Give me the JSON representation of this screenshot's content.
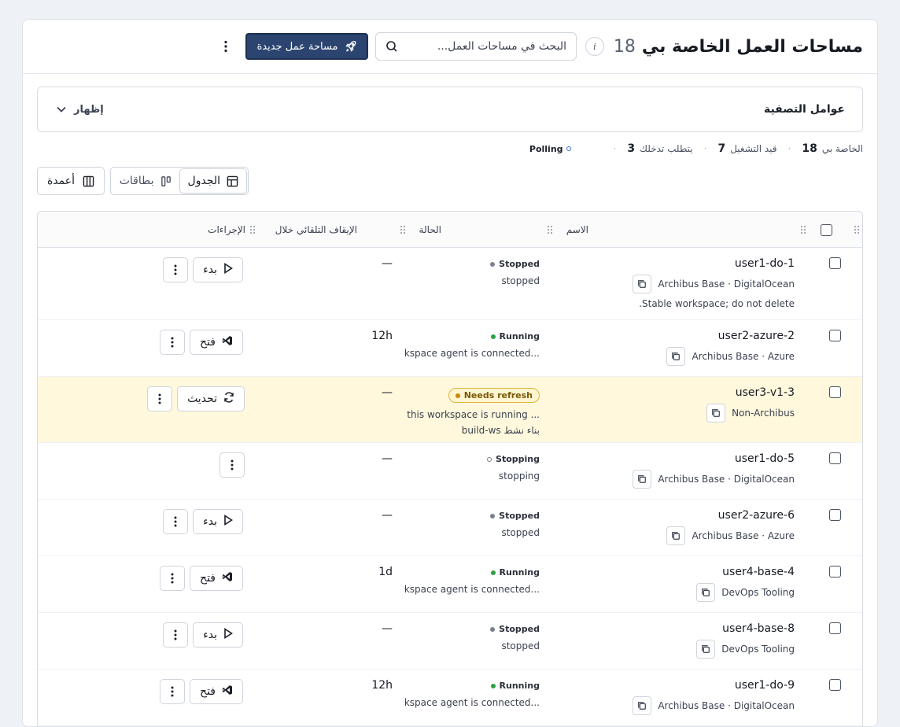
{
  "header": {
    "title": "مساحات العمل الخاصة بي",
    "count": "18",
    "info_icon": "i",
    "search_placeholder": "البحث في مساحات العمل...",
    "new_button": "مساحة عمل جديدة"
  },
  "filters": {
    "title": "عوامل التصفية",
    "toggle": "إظهار"
  },
  "summary": {
    "mine_label": "الخاصة بي",
    "mine_count": "18",
    "running_label": "قيد التشغيل",
    "running_count": "7",
    "attention_label": "يتطلب تدخلك",
    "attention_count": "3",
    "polling": "Polling"
  },
  "view": {
    "table": "الجدول",
    "cards": "بطاقات",
    "columns": "أعمدة"
  },
  "table": {
    "columns": {
      "name": "الاسم",
      "status": "الحالة",
      "autostop": "الإيقاف التلقائي خلال",
      "actions": "الإجراءات"
    },
    "rows": [
      {
        "name": "user1-do-1",
        "template": "Archibus Base · DigitalOcean",
        "note": "Stable workspace; do not delete.",
        "status": "Stopped",
        "status_color": "#7a808c",
        "status_sub": "stopped",
        "status_sub2": "",
        "autostop": "—",
        "action": "بدء",
        "action_icon": "play"
      },
      {
        "name": "user2-azure-2",
        "template": "Archibus Base · Azure",
        "note": "",
        "status": "Running",
        "status_color": "#2ea043",
        "status_sub": "...kspace agent is connected",
        "status_sub2": "",
        "autostop": "12h",
        "action": "فتح",
        "action_icon": "vscode"
      },
      {
        "name": "user3-v1-3",
        "template": "Non-Archibus",
        "note": "",
        "status": "Needs refresh",
        "status_color": "#c98a00",
        "status_sub": "... this workspace is running",
        "status_sub2": "بناء نشط build-ws",
        "autostop": "—",
        "action": "تحديث",
        "action_icon": "refresh"
      },
      {
        "name": "user1-do-5",
        "template": "Archibus Base · DigitalOcean",
        "note": "",
        "status": "Stopping",
        "status_color": "#7a808c",
        "status_sub": "stopping",
        "status_sub2": "",
        "autostop": "—",
        "action": "",
        "action_icon": ""
      },
      {
        "name": "user2-azure-6",
        "template": "Archibus Base · Azure",
        "note": "",
        "status": "Stopped",
        "status_color": "#7a808c",
        "status_sub": "stopped",
        "status_sub2": "",
        "autostop": "—",
        "action": "بدء",
        "action_icon": "play"
      },
      {
        "name": "user4-base-4",
        "template": "DevOps Tooling",
        "note": "",
        "status": "Running",
        "status_color": "#2ea043",
        "status_sub": "...kspace agent is connected",
        "status_sub2": "",
        "autostop": "1d",
        "action": "فتح",
        "action_icon": "vscode"
      },
      {
        "name": "user4-base-8",
        "template": "DevOps Tooling",
        "note": "",
        "status": "Stopped",
        "status_color": "#7a808c",
        "status_sub": "stopped",
        "status_sub2": "",
        "autostop": "—",
        "action": "بدء",
        "action_icon": "play"
      },
      {
        "name": "user1-do-9",
        "template": "Archibus Base · DigitalOcean",
        "note": "",
        "status": "Running",
        "status_color": "#2ea043",
        "status_sub": "...kspace agent is connected",
        "status_sub2": "",
        "autostop": "12h",
        "action": "فتح",
        "action_icon": "vscode"
      }
    ]
  },
  "colors": {
    "primary": "#2c4470",
    "running": "#2ea043",
    "stopped": "#7a808c",
    "needs_refresh": "#c98a00",
    "highlight_row": "#fff8dd"
  }
}
